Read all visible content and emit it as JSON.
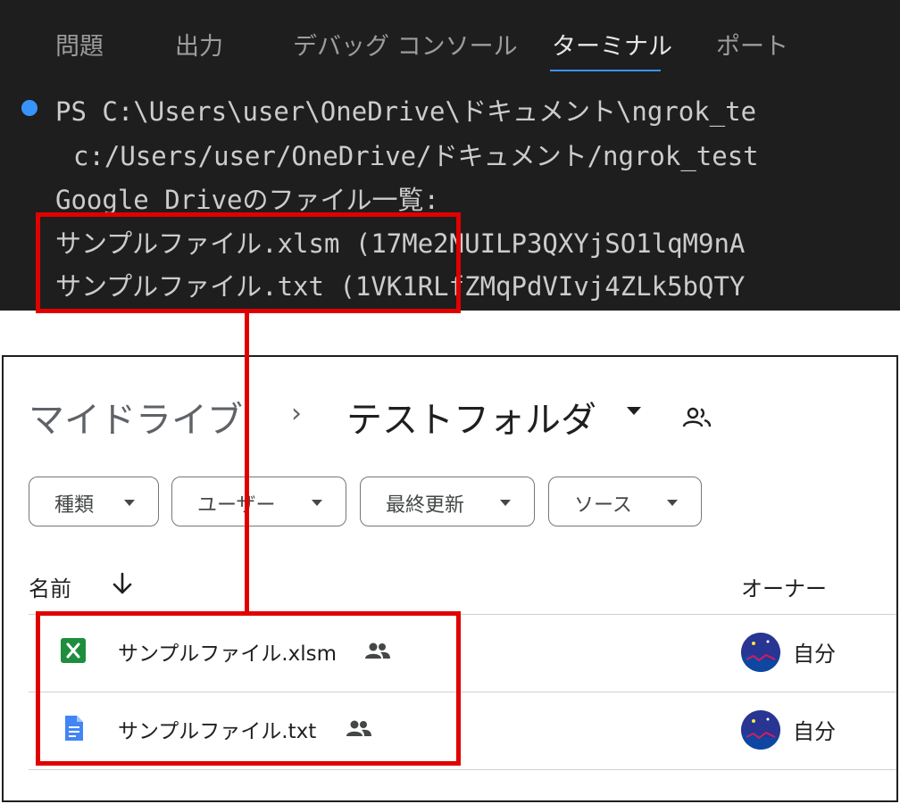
{
  "terminal": {
    "tabs": [
      {
        "label": "問題"
      },
      {
        "label": "出力"
      },
      {
        "label": "デバッグ コンソール"
      },
      {
        "label": "ターミナル"
      },
      {
        "label": "ポート"
      }
    ],
    "active_tab": "ターミナル",
    "lines": [
      "PS C:\\Users\\user\\OneDrive\\ドキュメント\\ngrok_te",
      "c:/Users/user/OneDrive/ドキュメント/ngrok_test",
      "Google Driveのファイル一覧:",
      "サンプルファイル.xlsm (17Me2NUILP3QXYjSO1lqM9nA",
      "サンプルファイル.txt (1VK1RLfZMqPdVIvj4ZLk5bQTY"
    ],
    "accent_color": "#3794ff"
  },
  "drive": {
    "breadcrumb": {
      "root": "マイドライブ",
      "separator": "›",
      "folder": "テストフォルダ"
    },
    "filters": [
      {
        "label": "種類"
      },
      {
        "label": "ユーザー"
      },
      {
        "label": "最終更新"
      },
      {
        "label": "ソース"
      }
    ],
    "columns": {
      "name": "名前",
      "owner": "オーナー"
    },
    "files": [
      {
        "name": "サンプルファイル.xlsm",
        "type_icon": "excel-icon",
        "owner": "自分",
        "shared": true
      },
      {
        "name": "サンプルファイル.txt",
        "type_icon": "docs-icon",
        "owner": "自分",
        "shared": true
      }
    ]
  },
  "colors": {
    "annotation_red": "#e00000",
    "excel_green": "#1e8e3e",
    "docs_blue": "#4285f4"
  }
}
